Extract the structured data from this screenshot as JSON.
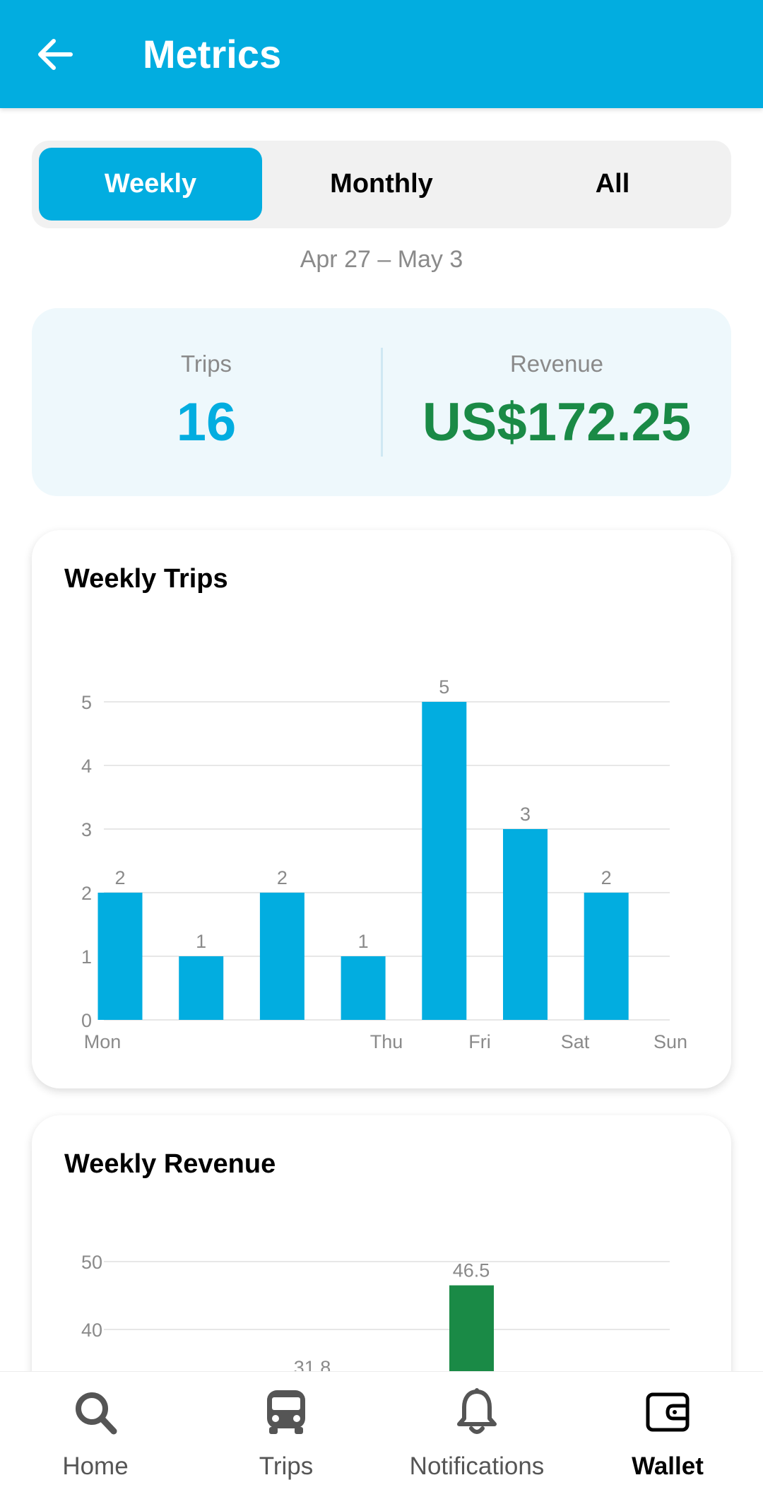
{
  "appbar": {
    "title": "Metrics",
    "back_icon": "arrow-left-icon"
  },
  "period_tabs": [
    {
      "label": "Weekly",
      "active": true
    },
    {
      "label": "Monthly",
      "active": false
    },
    {
      "label": "All",
      "active": false
    }
  ],
  "date_range": "Apr 27 – May 3",
  "summary": {
    "trips_label": "Trips",
    "trips_value": "16",
    "revenue_label": "Revenue",
    "revenue_value": "US$172.25"
  },
  "colors": {
    "primary": "#02ade0",
    "revenue": "#1a8a46",
    "summary_bg": "#eef8fc"
  },
  "chart_data": [
    {
      "type": "bar",
      "title": "Weekly Trips",
      "categories": [
        "Mon",
        "",
        "",
        "Thu",
        "Fri",
        "Sat",
        "Sun"
      ],
      "values": [
        2,
        1,
        2,
        1,
        5,
        3,
        2
      ],
      "data_labels": [
        "2",
        "1",
        "2",
        "1",
        "5",
        "3",
        "2"
      ],
      "y_ticks": [
        "0",
        "1",
        "2",
        "3",
        "4",
        "5"
      ],
      "ylim": [
        0,
        5
      ],
      "grid": true,
      "color": "#02ade0"
    },
    {
      "type": "bar",
      "title": "Weekly Revenue",
      "values_visible": [
        46.5
      ],
      "data_labels_visible": [
        "46.5",
        "31.8"
      ],
      "y_ticks_visible": [
        "50",
        "40"
      ],
      "grid": true,
      "color": "#1a8a46"
    }
  ],
  "bottom_nav": [
    {
      "label": "Home",
      "icon": "search-icon",
      "active": false
    },
    {
      "label": "Trips",
      "icon": "bus-icon",
      "active": false
    },
    {
      "label": "Notifications",
      "icon": "bell-icon",
      "active": false
    },
    {
      "label": "Wallet",
      "icon": "wallet-icon",
      "active": true
    }
  ]
}
